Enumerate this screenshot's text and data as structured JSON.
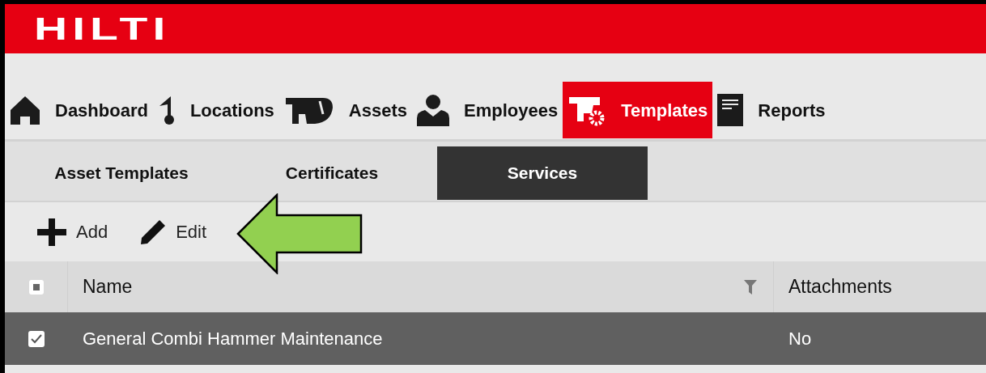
{
  "header": {
    "logo": "HILTI"
  },
  "nav": [
    {
      "kind": "home",
      "label": "Dashboard",
      "selected": false
    },
    {
      "kind": "pin",
      "label": "Locations",
      "selected": false
    },
    {
      "kind": "tool",
      "label": "Assets",
      "selected": false
    },
    {
      "kind": "person",
      "label": "Employees",
      "selected": false
    },
    {
      "kind": "template",
      "label": "Templates",
      "selected": true
    },
    {
      "kind": "report",
      "label": "Reports",
      "selected": false
    }
  ],
  "subtabs": [
    {
      "label": "Asset Templates",
      "selected": false
    },
    {
      "label": "Certificates",
      "selected": false
    },
    {
      "label": "Services",
      "selected": true
    }
  ],
  "toolbar": [
    {
      "kind": "add",
      "label": "Add"
    },
    {
      "kind": "edit",
      "label": "Edit"
    }
  ],
  "table": {
    "select_all": {
      "partial": true
    },
    "columns": [
      {
        "label": "Name",
        "filter": true
      },
      {
        "label": "Attachments",
        "filter": false
      }
    ],
    "rows": [
      {
        "selected": true,
        "cells": [
          "General Combi Hammer Maintenance",
          "No"
        ]
      }
    ]
  },
  "annotation": {
    "kind": "arrow"
  }
}
